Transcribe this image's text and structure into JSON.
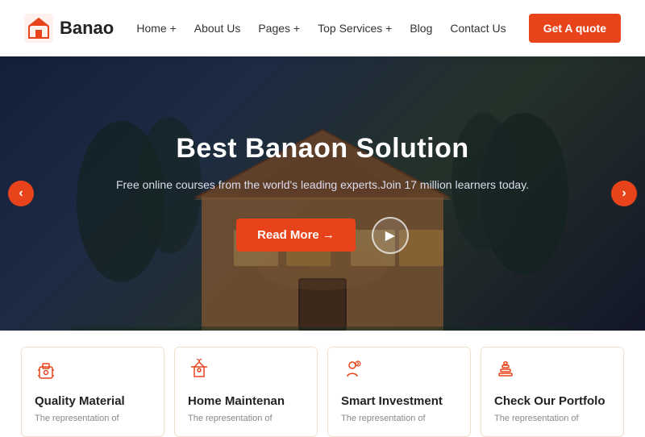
{
  "navbar": {
    "logo_text": "Banao",
    "nav_items": [
      {
        "label": "Home +",
        "id": "home"
      },
      {
        "label": "About Us",
        "id": "about"
      },
      {
        "label": "Pages +",
        "id": "pages"
      },
      {
        "label": "Top Services +",
        "id": "services"
      },
      {
        "label": "Blog",
        "id": "blog"
      },
      {
        "label": "Contact Us",
        "id": "contact"
      }
    ],
    "cta_label": "Get A quote"
  },
  "hero": {
    "title": "Best Banaon Solution",
    "subtitle": "Free online courses from the world's leading experts.Join 17 million learners today.",
    "btn_label": "Read More →",
    "arrow_left": "‹",
    "arrow_right": "›"
  },
  "cards": [
    {
      "id": "quality",
      "icon": "🤖",
      "title": "Quality Material",
      "desc": "The representation of"
    },
    {
      "id": "maintenance",
      "icon": "🏮",
      "title": "Home Maintenan",
      "desc": "The representation of"
    },
    {
      "id": "investment",
      "icon": "👤",
      "title": "Smart Investment",
      "desc": "The representation of"
    },
    {
      "id": "portfolio",
      "icon": "📚",
      "title": "Check Our Portfolo",
      "desc": "The representation of"
    }
  ]
}
